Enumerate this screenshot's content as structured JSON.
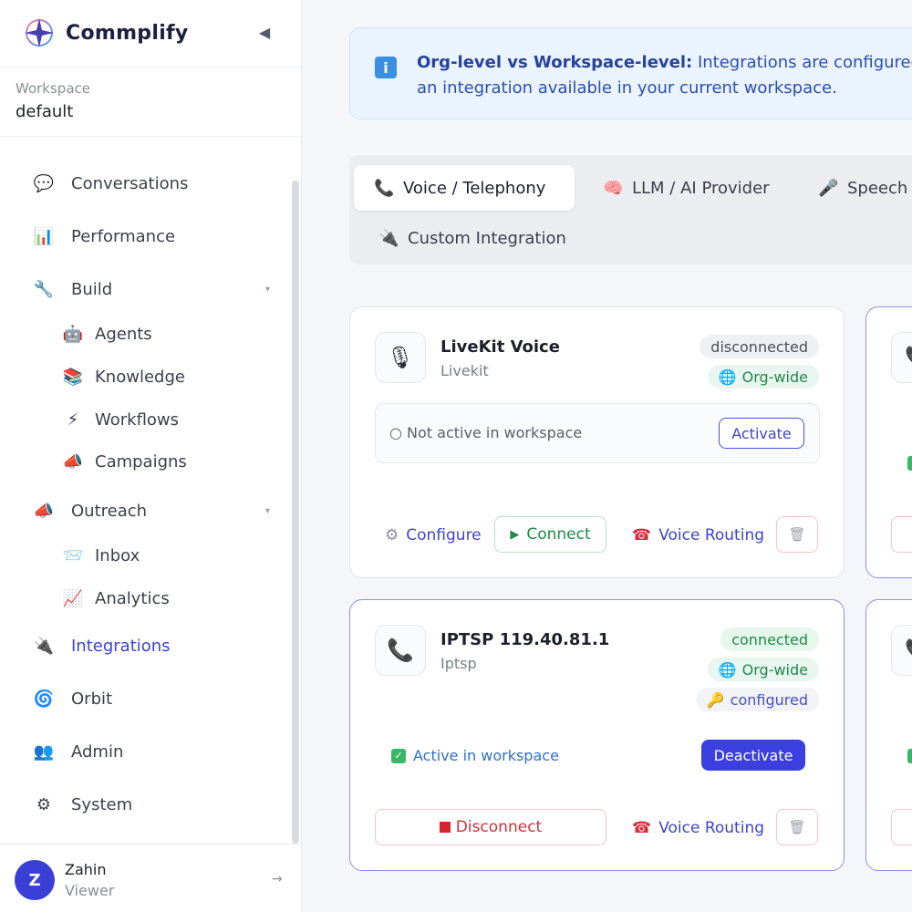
{
  "app": {
    "name": "Commplify",
    "collapse_glyph": "◀"
  },
  "workspace": {
    "label": "Workspace",
    "value": "default"
  },
  "nav": {
    "items": [
      {
        "label": "Conversations",
        "icon": "chat-bubble-icon",
        "glyph": "💬"
      },
      {
        "label": "Performance",
        "icon": "bar-chart-icon",
        "glyph": "📊"
      },
      {
        "label": "Build",
        "icon": "wrench-icon",
        "glyph": "🔧",
        "caret": "▾"
      },
      {
        "label": "Agents",
        "icon": "robot-icon",
        "glyph": "🤖"
      },
      {
        "label": "Knowledge",
        "icon": "books-icon",
        "glyph": "📚"
      },
      {
        "label": "Workflows",
        "icon": "lightning-icon",
        "glyph": "⚡"
      },
      {
        "label": "Campaigns",
        "icon": "megaphone-icon",
        "glyph": "📣"
      },
      {
        "label": "Outreach",
        "icon": "megaphone-icon",
        "glyph": "📣",
        "caret": "▾"
      },
      {
        "label": "Inbox",
        "icon": "inbox-icon",
        "glyph": "📨"
      },
      {
        "label": "Analytics",
        "icon": "line-chart-icon",
        "glyph": "📈"
      },
      {
        "label": "Integrations",
        "icon": "plug-icon",
        "glyph": "🔌"
      },
      {
        "label": "Orbit",
        "icon": "spiral-icon",
        "glyph": "🌀"
      },
      {
        "label": "Admin",
        "icon": "users-icon",
        "glyph": "👥"
      },
      {
        "label": "System",
        "icon": "gear-icon",
        "glyph": "⚙"
      }
    ]
  },
  "profile": {
    "initial": "Z",
    "name": "Zahin",
    "role": "Viewer",
    "logout_glyph": "→"
  },
  "banner": {
    "icon_glyph": "i",
    "bold": "Org-level vs Workspace-level:",
    "line1_rest": " Integrations are configured a",
    "line2": "an integration available in your current workspace."
  },
  "tabs": [
    {
      "label": "Voice / Telephony",
      "icon": "phone-icon",
      "glyph": "📞",
      "active": true
    },
    {
      "label": "LLM / AI Provider",
      "icon": "brain-icon",
      "glyph": "🧠"
    },
    {
      "label": "Speech",
      "icon": "microphone-icon",
      "glyph": "🎤"
    },
    {
      "label": "Custom Integration",
      "icon": "plug-icon",
      "glyph": "🔌"
    }
  ],
  "cards": [
    {
      "title": "LiveKit Voice",
      "subtitle": "Livekit",
      "icon": "microphone-icon",
      "glyph": "🎙",
      "status_badge": "disconnected",
      "scope_badge": "Org-wide",
      "workspace_status": "○ Not active in workspace",
      "activate_label": "Activate",
      "configure_label": "Configure",
      "connect_label": "Connect",
      "voice_routing_label": "Voice Routing"
    },
    {
      "title": "IPTSP 119.40.81.1",
      "subtitle": "Iptsp",
      "icon": "phone-icon",
      "glyph": "📞",
      "status_badge": "connected",
      "scope_badge": "Org-wide",
      "config_badge": "configured",
      "workspace_status": "Active in workspace",
      "deactivate_label": "Deactivate",
      "disconnect_label": "Disconnect",
      "voice_routing_label": "Voice Routing"
    }
  ],
  "glyphs": {
    "gear": "⚙",
    "play": "▶",
    "phone_small": "☎",
    "globe": "🌐",
    "key": "🔑",
    "trash": "🗑",
    "check": "✓"
  },
  "colors": {
    "accent": "#3b3fe0",
    "connected_border": "#8f8ff0",
    "success": "#1f8a4a",
    "danger": "#d0303c"
  }
}
